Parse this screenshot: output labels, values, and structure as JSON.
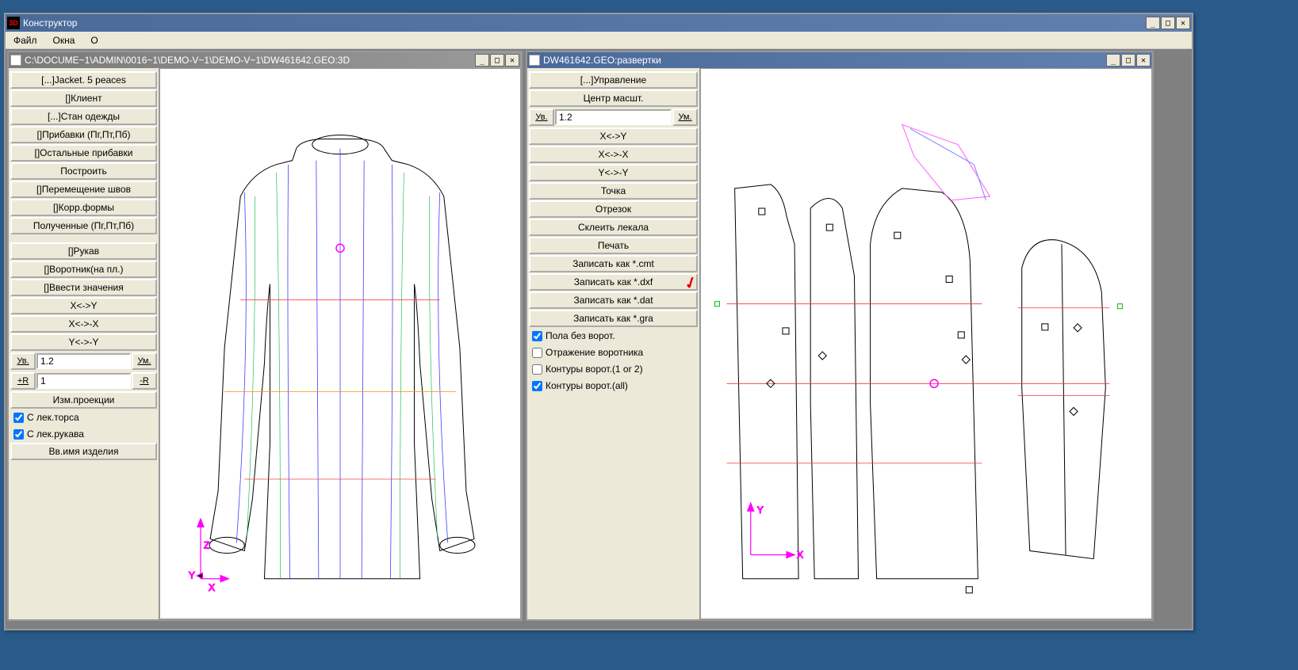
{
  "main": {
    "title": "Конструктор",
    "menu": {
      "file": "Файл",
      "windows": "Окна",
      "about": "О"
    }
  },
  "left": {
    "title": "C:\\DOCUME~1\\ADMIN\\0016~1\\DEMO-V~1\\DEMO-V~1\\DW461642.GEO:3D",
    "buttons": {
      "jacket": "[...]Jacket. 5 peaces",
      "client": "[]Клиент",
      "stan": "[...]Стан одежды",
      "pribavki": "[]Прибавки (Пг,Пт,Пб)",
      "ost_prib": "[]Остальные прибавки",
      "build": "Построить",
      "move_seams": "[]Перемещение швов",
      "korr": "[]Корр.формы",
      "received": "Полученные (Пг,Пт,Пб)",
      "sleeve": "[]Рукав",
      "collar": "[]Воротник(на пл.)",
      "enter_val": "[]Ввести значения",
      "xy": "X<->Y",
      "xx": "X<->-X",
      "yy": "Y<->-Y",
      "zoom_in": "Ув.",
      "zoom_out": "Ум.",
      "zoom_val": "1.2",
      "plus_r": "+R",
      "minus_r": "-R",
      "r_val": "1",
      "proj": "Изм.проекции",
      "torso": "С лек.торса",
      "sleeve_pat": "С лек.рукава",
      "name": "Вв.имя изделия"
    },
    "checks": {
      "torso": true,
      "sleeve": true
    }
  },
  "right": {
    "title": "DW461642.GEO:развертки",
    "buttons": {
      "manage": "[...]Управление",
      "center": "Центр масшт.",
      "zoom_in": "Ув.",
      "zoom_out": "Ум.",
      "zoom_val": "1.2",
      "xy": "X<->Y",
      "xx": "X<->-X",
      "yy": "Y<->-Y",
      "point": "Точка",
      "segment": "Отрезок",
      "merge": "Склеить лекала",
      "print": "Печать",
      "save_cmt": "Записать как *.cmt",
      "save_dxf": "Записать как *.dxf",
      "save_dat": "Записать как *.dat",
      "save_gra": "Записать как *.gra",
      "pola": "Пола без ворот.",
      "reflect": "Отражение воротника",
      "contour12": "Контуры ворот.(1 or 2)",
      "contour_all": "Контуры ворот.(all)"
    },
    "checks": {
      "pola": true,
      "reflect": false,
      "contour12": false,
      "contour_all": true
    }
  }
}
